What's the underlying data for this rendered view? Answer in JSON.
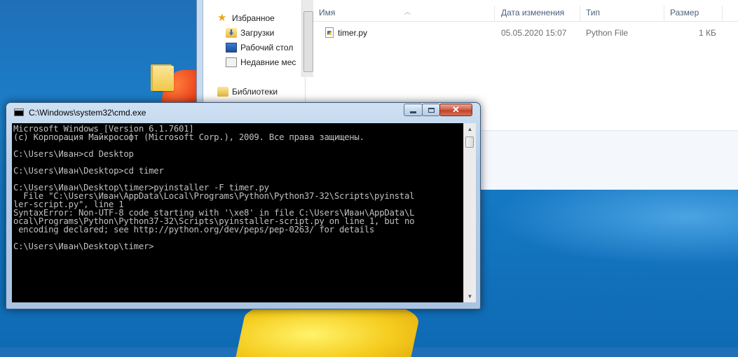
{
  "desktop": {
    "folder_icon": "folder-icon"
  },
  "explorer": {
    "nav": {
      "favorites": "Избранное",
      "downloads": "Загрузки",
      "desktop": "Рабочий стол",
      "recent": "Недавние мес",
      "libraries": "Библиотеки"
    },
    "columns": {
      "name": "Имя",
      "date": "Дата изменения",
      "type": "Тип",
      "size": "Размер"
    },
    "files": [
      {
        "name": "timer.py",
        "date": "05.05.2020 15:07",
        "type": "Python File",
        "size": "1 КБ"
      }
    ]
  },
  "cmd": {
    "title": "C:\\Windows\\system32\\cmd.exe",
    "close_label": "✕",
    "console": "Microsoft Windows [Version 6.1.7601]\n(c) Корпорация Майкрософт (Microsoft Corp.), 2009. Все права защищены.\n\nC:\\Users\\Иван>cd Desktop\n\nC:\\Users\\Иван\\Desktop>cd timer\n\nC:\\Users\\Иван\\Desktop\\timer>pyinstaller -F timer.py\n  File \"C:\\Users\\Иван\\AppData\\Local\\Programs\\Python\\Python37-32\\Scripts\\pyinstal\nler-script.py\", line 1\nSyntaxError: Non-UTF-8 code starting with '\\xe8' in file C:\\Users\\Иван\\AppData\\L\nocal\\Programs\\Python\\Python37-32\\Scripts\\pyinstaller-script.py on line 1, but no\n encoding declared; see http://python.org/dev/peps/pep-0263/ for details\n\nC:\\Users\\Иван\\Desktop\\timer>"
  },
  "colors": {
    "console_bg": "#000000",
    "console_fg": "#c0c0c0",
    "desktop_bg": "#1b7fc9"
  }
}
